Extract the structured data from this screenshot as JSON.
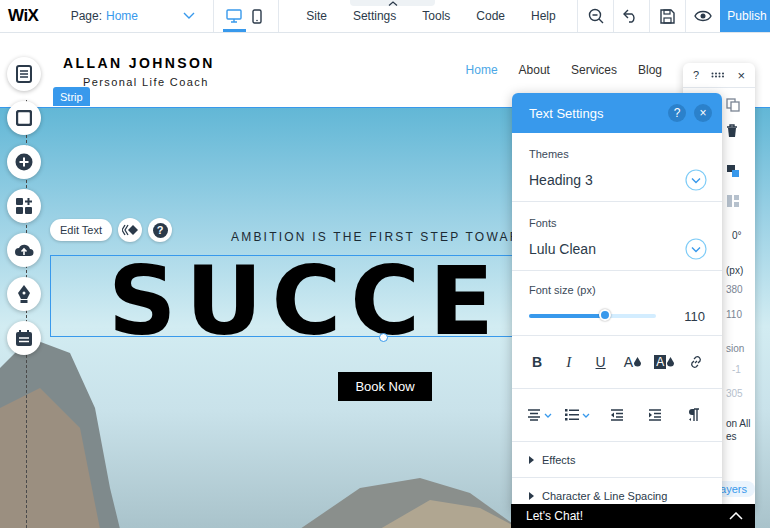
{
  "topbar": {
    "logo": "WiX",
    "page_label": "Page:",
    "page_name": "Home",
    "views": [
      {
        "kind": "desktop",
        "selected": true
      },
      {
        "kind": "mobile",
        "selected": false
      }
    ],
    "menu": [
      "Site",
      "Settings",
      "Tools",
      "Code",
      "Help"
    ],
    "publish": "Publish"
  },
  "site": {
    "name": "ALLAN JOHNSON",
    "tagline": "Personal Life Coach",
    "nav": [
      {
        "label": "Home",
        "selected": true
      },
      {
        "label": "About",
        "selected": false
      },
      {
        "label": "Services",
        "selected": false
      },
      {
        "label": "Blog",
        "selected": false
      }
    ]
  },
  "strip_label": "Strip",
  "element_toolbar": {
    "edit": "Edit Text",
    "help": "?"
  },
  "hero": {
    "subtitle": "AMBITION IS THE FIRST STEP TOWAR",
    "title": "SUCCE",
    "button": "Book Now"
  },
  "text_settings": {
    "title": "Text Settings",
    "help": "?",
    "close": "×",
    "theme_label": "Themes",
    "theme": "Heading 3",
    "font_label": "Fonts",
    "font": "Lulu Clean",
    "size_label": "Font size (px)",
    "size_value": "110",
    "size_level": 0.6,
    "format": [
      {
        "kind": "bold",
        "label": "B"
      },
      {
        "kind": "italic",
        "label": "I"
      },
      {
        "kind": "underline",
        "label": "U"
      },
      {
        "kind": "color",
        "label": "A"
      },
      {
        "kind": "highlight",
        "label": "A"
      },
      {
        "kind": "link"
      }
    ],
    "sections": [
      {
        "label": "Effects",
        "expanded": false
      },
      {
        "label": "Character & Line Spacing",
        "expanded": false
      }
    ]
  },
  "side_panel": {
    "help": "?",
    "close": "×",
    "items": [
      "0°",
      "(px)",
      "380",
      "110",
      "sion",
      "-1",
      "305",
      "on All",
      "es"
    ],
    "layers": "Layers"
  },
  "chat": {
    "label": "Let's Chat!",
    "expanded": false
  }
}
